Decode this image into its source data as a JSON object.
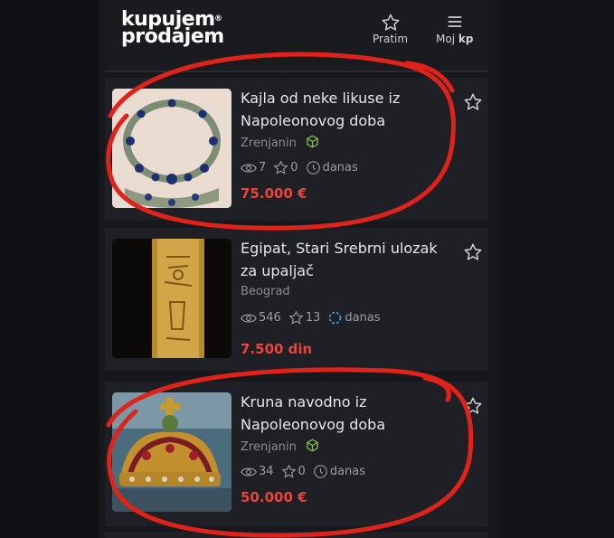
{
  "app": {
    "logo_line1": "kupujem",
    "logo_line2": "prodajem",
    "logo_mark": "®"
  },
  "nav": {
    "follow_label": "Pratim",
    "mykp_label_prefix": "Moj",
    "mykp_label_suffix": "kp"
  },
  "listings": [
    {
      "title": "Kajla od neke likuse iz Napoleonovog doba",
      "city": "Zrenjanin",
      "views": "7",
      "favorites": "0",
      "time": "danas",
      "price": "75.000 €"
    },
    {
      "title": "Egipat, Stari Srebrni ulozak za upaljač",
      "city": "Beograd",
      "views": "546",
      "favorites": "13",
      "time": "danas",
      "price": "7.500 din"
    },
    {
      "title": "Kruna navodno iz Napoleonovog doba",
      "city": "Zrenjanin",
      "views": "34",
      "favorites": "0",
      "time": "danas",
      "price": "50.000 €"
    }
  ],
  "colors": {
    "price": "#e8453c",
    "annotation": "#e0231a",
    "card_bg": "#1f2025",
    "delivery_badge": "#8bc34a"
  }
}
